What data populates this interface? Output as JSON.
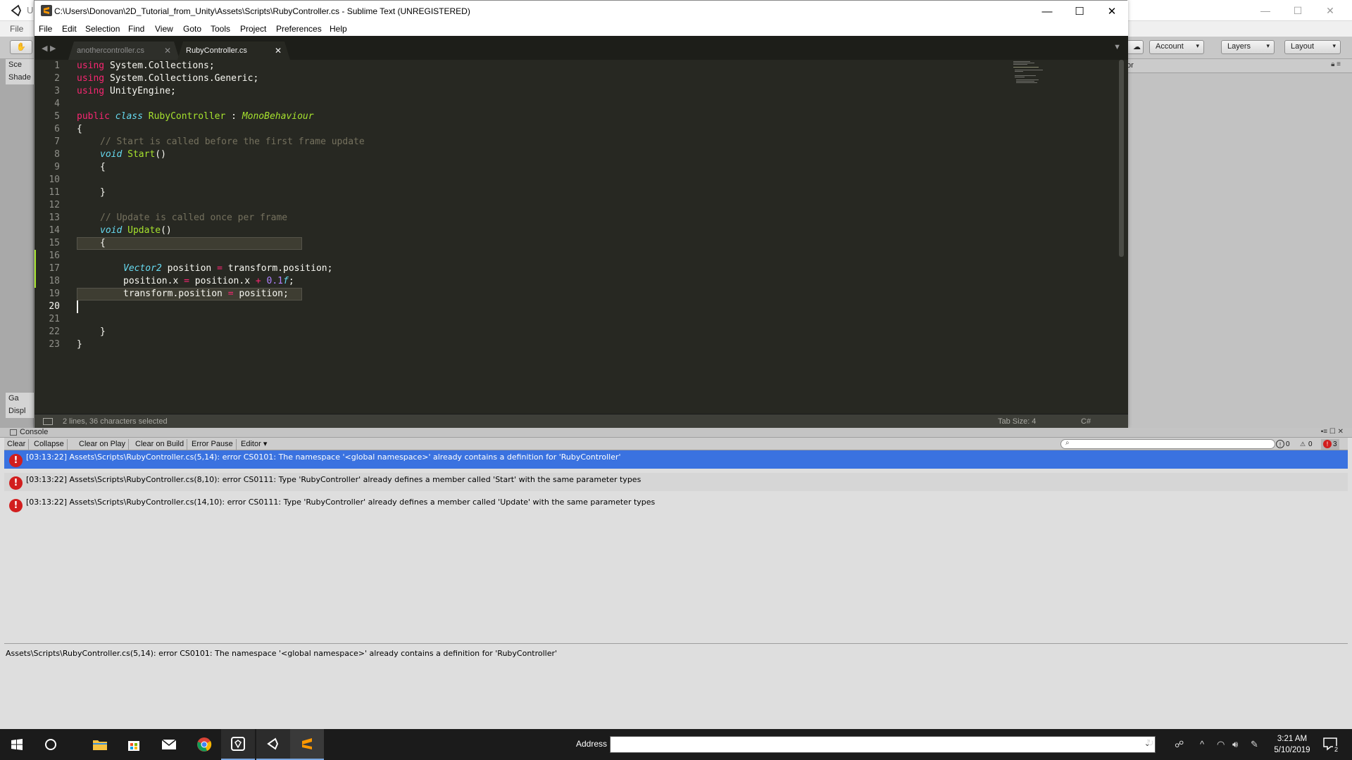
{
  "unity": {
    "title_fragment": "U",
    "menu": [
      "File"
    ],
    "toolbar": {
      "account": "Account",
      "layers": "Layers",
      "layout": "Layout"
    },
    "left_tabs": [
      "Sce",
      "Shade",
      "Ga",
      "Displ"
    ],
    "right_header_fragment": "or"
  },
  "sublime": {
    "title": "C:\\Users\\Donovan\\2D_Tutorial_from_Unity\\Assets\\Scripts\\RubyController.cs - Sublime Text (UNREGISTERED)",
    "menu": [
      "File",
      "Edit",
      "Selection",
      "Find",
      "View",
      "Goto",
      "Tools",
      "Project",
      "Preferences",
      "Help"
    ],
    "tabs": [
      {
        "label": "anothercontroller.cs",
        "active": false
      },
      {
        "label": "RubyController.cs",
        "active": true
      }
    ],
    "line_numbers": [
      "1",
      "2",
      "3",
      "4",
      "5",
      "6",
      "7",
      "8",
      "9",
      "10",
      "11",
      "12",
      "13",
      "14",
      "15",
      "16",
      "17",
      "18",
      "19",
      "20",
      "21",
      "22",
      "23"
    ],
    "code": {
      "l1_kw": "using",
      "l1_rest": " System.Collections;",
      "l2_kw": "using",
      "l2_rest": " System.Collections.Generic;",
      "l3_kw": "using",
      "l3_rest": " UnityEngine;",
      "l5_public": "public",
      "l5_class": "class",
      "l5_name": "RubyController",
      "l5_colon": " : ",
      "l5_base": "MonoBehaviour",
      "l6": "{",
      "l7": "// Start is called before the first frame update",
      "l8_void": "void",
      "l8_fn": "Start",
      "l8_paren": "()",
      "l9": "{",
      "l11": "}",
      "l13": "// Update is called once per frame",
      "l14_void": "void",
      "l14_fn": "Update",
      "l14_paren": "()",
      "l15": "{",
      "l17_type": "Vector2",
      "l17_a": " position ",
      "l17_op": "=",
      "l17_b": " transform.position;",
      "l18_a": "position.x ",
      "l18_op1": "=",
      "l18_b": " position.x ",
      "l18_op2": "+",
      "l18_num": " 0.1",
      "l18_f": "f",
      "l18_end": ";",
      "l19_a": "transform.position ",
      "l19_op": "=",
      "l19_b": " position;",
      "l21": "}",
      "l22": "}"
    },
    "status": {
      "selection": "2 lines, 36 characters selected",
      "tab_size": "Tab Size: 4",
      "syntax": "C#"
    }
  },
  "console": {
    "tab_label": "Console",
    "toolbar": [
      "Clear",
      "Collapse",
      "Clear on Play",
      "Clear on Build",
      "Error Pause",
      "Editor"
    ],
    "counts": {
      "info": "0",
      "warnings": "0",
      "errors": "3"
    },
    "logs": [
      "[03:13:22] Assets\\Scripts\\RubyController.cs(5,14): error CS0101: The namespace '<global namespace>' already contains a definition for 'RubyController'",
      "[03:13:22] Assets\\Scripts\\RubyController.cs(8,10): error CS0111: Type 'RubyController' already defines a member called 'Start' with the same parameter types",
      "[03:13:22] Assets\\Scripts\\RubyController.cs(14,10): error CS0111: Type 'RubyController' already defines a member called 'Update' with the same parameter types"
    ],
    "detail": "Assets\\Scripts\\RubyController.cs(5,14): error CS0101: The namespace '<global namespace>' already contains a definition for 'RubyController'"
  },
  "taskbar": {
    "address_label": "Address",
    "time": "3:21 AM",
    "date": "5/10/2019",
    "notifications": "2"
  },
  "colors": {
    "editor_bg": "#272822",
    "keyword": "#f92672",
    "storage": "#66d9ef",
    "entity": "#a6e22e",
    "comment": "#75715e",
    "number": "#ae81ff",
    "selected_log": "#3a72e0",
    "error_icon": "#d21e1e"
  }
}
